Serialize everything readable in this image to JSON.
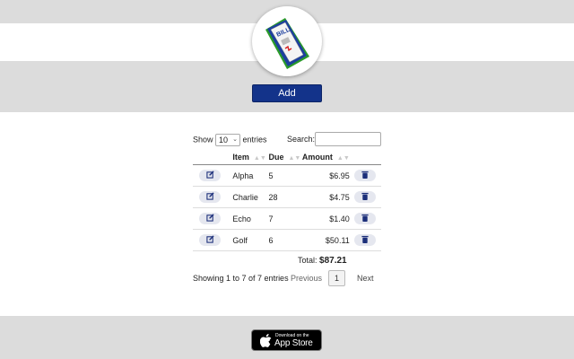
{
  "header": {
    "add_label": "Add"
  },
  "controls": {
    "show_label": "Show",
    "entries_value": "10",
    "entries_label": "entries",
    "search_label": "Search:",
    "search_value": ""
  },
  "table": {
    "headers": {
      "item": "Item",
      "due": "Due",
      "amount": "Amount"
    },
    "rows": [
      {
        "item": "Alpha",
        "due": "5",
        "amount": "$6.95"
      },
      {
        "item": "Charlie",
        "due": "28",
        "amount": "$4.75"
      },
      {
        "item": "Echo",
        "due": "7",
        "amount": "$1.40"
      },
      {
        "item": "Golf",
        "due": "6",
        "amount": "$50.11"
      }
    ]
  },
  "summary": {
    "total_label": "Total:",
    "total_value": "$87.21"
  },
  "pagination": {
    "info": "Showing 1 to 7 of 7 entries",
    "previous": "Previous",
    "current": "1",
    "next": "Next"
  },
  "footer": {
    "appstore_small": "Download on the",
    "appstore_big": "App Store"
  },
  "logo": {
    "text": "BILL"
  },
  "colors": {
    "accent": "#13338a",
    "band": "#dcdcdc",
    "icon": "#1c2f7a"
  }
}
